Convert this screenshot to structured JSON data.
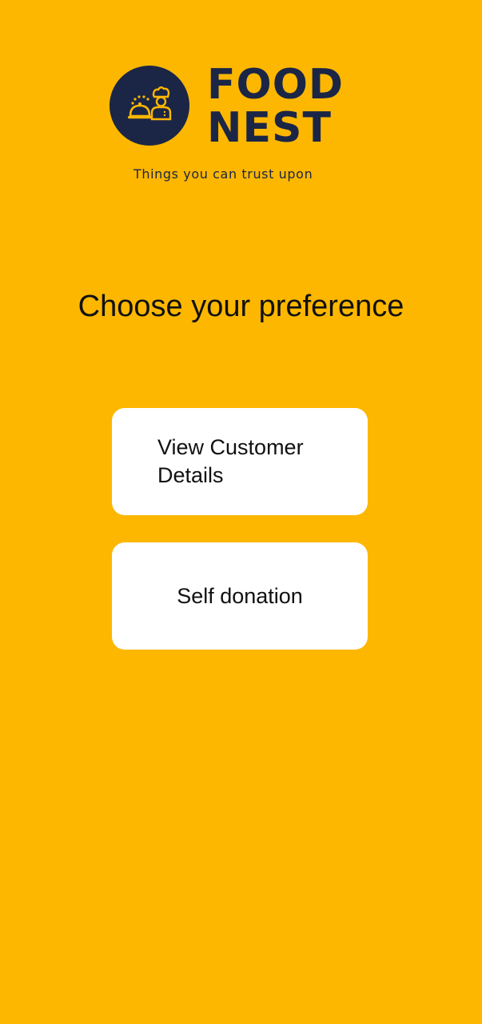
{
  "brand": {
    "line1": "FOOD",
    "line2": "NEST",
    "tagline": "Things you can trust upon",
    "logo_icon": "chef-serving-cloche-icon",
    "colors": {
      "background": "#FDB700",
      "navy": "#1B2646",
      "card": "#FFFFFF"
    }
  },
  "heading": "Choose your preference",
  "options": [
    {
      "label": "View Customer Details"
    },
    {
      "label": "Self donation"
    }
  ]
}
